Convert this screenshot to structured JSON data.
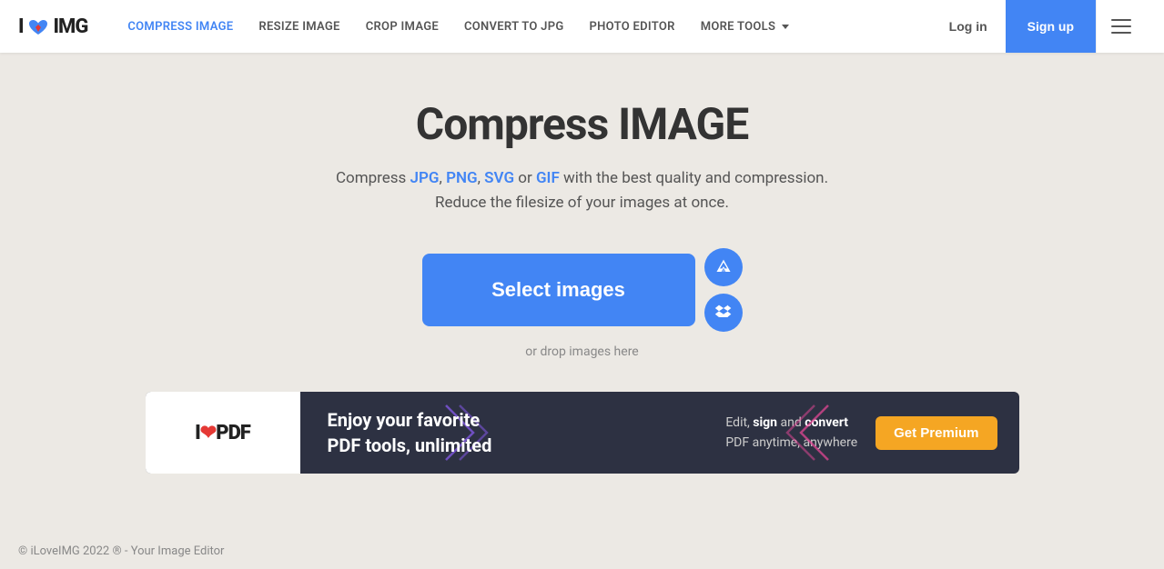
{
  "brand": {
    "name_part1": "I",
    "name_part2": "IMG"
  },
  "nav": {
    "links": [
      {
        "id": "compress",
        "label": "COMPRESS IMAGE",
        "active": true
      },
      {
        "id": "resize",
        "label": "RESIZE IMAGE",
        "active": false
      },
      {
        "id": "crop",
        "label": "CROP IMAGE",
        "active": false
      },
      {
        "id": "convert",
        "label": "CONVERT TO JPG",
        "active": false
      },
      {
        "id": "photo",
        "label": "PHOTO EDITOR",
        "active": false
      },
      {
        "id": "more",
        "label": "MORE TOOLS",
        "active": false,
        "hasArrow": true
      }
    ],
    "login_label": "Log in",
    "signup_label": "Sign up"
  },
  "hero": {
    "title": "Compress IMAGE",
    "subtitle_prefix": "Compress ",
    "formats": [
      {
        "label": "JPG",
        "color": "#4285f4"
      },
      {
        "label": "PNG",
        "color": "#4285f4"
      },
      {
        "label": "SVG",
        "color": "#4285f4"
      },
      {
        "label": "GIF",
        "color": "#4285f4"
      }
    ],
    "subtitle_middle": " or ",
    "subtitle_suffix": " with the best quality and compression.",
    "subtitle_line2": "Reduce the filesize of your images at once.",
    "select_button": "Select images",
    "drop_text": "or drop images here"
  },
  "ad": {
    "logo": "I❤PDF",
    "headline_line1": "Enjoy your favorite",
    "headline_line2": "PDF tools, unlimited",
    "subtext_part1": "Edit, ",
    "subtext_sign": "sign",
    "subtext_part2": " and ",
    "subtext_convert": "convert",
    "subtext_part3": " PDF anytime, anywhere",
    "cta": "Get Premium"
  },
  "footer": {
    "text": "© iLoveIMG 2022 ® - Your Image Editor"
  }
}
